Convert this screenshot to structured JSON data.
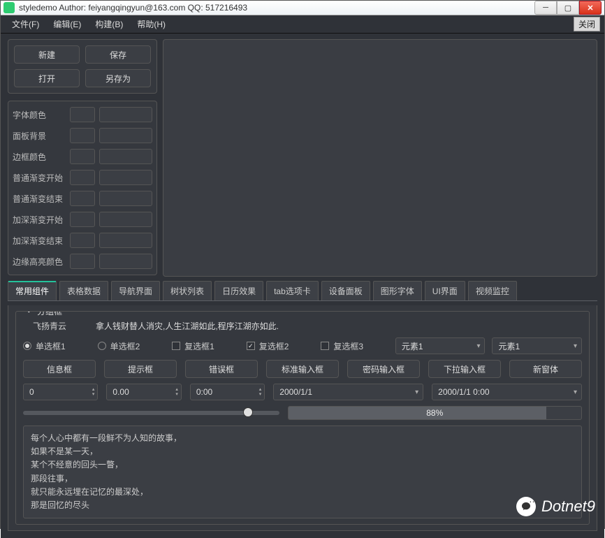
{
  "window": {
    "title": "styledemo    Author: feiyangqingyun@163.com    QQ: 517216493"
  },
  "menu": {
    "file": "文件(F)",
    "edit": "编辑(E)",
    "build": "构建(B)",
    "help": "帮助(H)",
    "close": "关闭"
  },
  "toolbar": {
    "new": "新建",
    "save": "保存",
    "open": "打开",
    "saveas": "另存为"
  },
  "config": {
    "fontColor": "字体颜色",
    "panelBg": "面板背景",
    "borderColor": "边框颜色",
    "normalGradStart": "普通渐变开始",
    "normalGradEnd": "普通渐变结束",
    "deepGradStart": "加深渐变开始",
    "deepGradEnd": "加深渐变结束",
    "edgeHighlight": "边缘高亮颜色"
  },
  "tabs": [
    "常用组件",
    "表格数据",
    "导航界面",
    "树状列表",
    "日历效果",
    "tab选项卡",
    "设备面板",
    "图形字体",
    "UI界面",
    "视频监控"
  ],
  "group": {
    "title": "分组框",
    "nameLabel": "飞扬青云",
    "slogan": "拿人钱财替人消灾,人生江湖如此,程序江湖亦如此.",
    "radio1": "单选框1",
    "radio2": "单选框2",
    "check1": "复选框1",
    "check2": "复选框2",
    "check3": "复选框3",
    "combo1": "元素1",
    "combo2": "元素1",
    "btns": {
      "info": "信息框",
      "tip": "提示框",
      "error": "错误框",
      "stdin": "标准输入框",
      "pwdin": "密码输入框",
      "dropin": "下拉输入框",
      "newwin": "新窗体"
    },
    "spin1": "0",
    "spin2": "0.00",
    "time": "0:00",
    "date": "2000/1/1",
    "datetime": "2000/1/1 0:00",
    "sliderValue": 88,
    "progressValue": 88,
    "progressLabel": "88%",
    "text": "每个人心中都有一段鲜不为人知的故事，\n如果不是某一天，\n某个不经意的回头一瞥，\n那段往事，\n就只能永远埋在记忆的最深处，\n那是回忆的尽头"
  },
  "watermark": "Dotnet9"
}
